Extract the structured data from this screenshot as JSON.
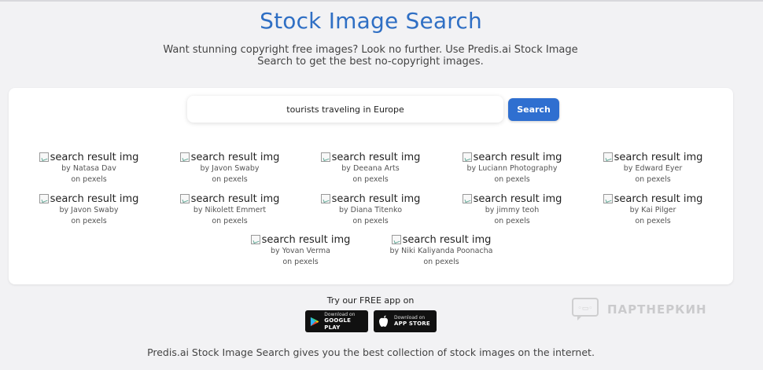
{
  "header": {
    "title": "Stock Image Search",
    "subtitle_line1": "Want stunning copyright free images? Look no further. Use Predis.ai Stock Image",
    "subtitle_line2": "Search to get the best no-copyright images."
  },
  "search": {
    "value": "tourists traveling in Europe",
    "button_label": "Search"
  },
  "results": [
    {
      "alt": "search result img",
      "by": "by Natasa Dav",
      "source": "on pexels"
    },
    {
      "alt": "search result img",
      "by": "by Javon Swaby",
      "source": "on pexels"
    },
    {
      "alt": "search result img",
      "by": "by Deeana Arts",
      "source": "on pexels"
    },
    {
      "alt": "search result img",
      "by": "by Luciann Photography",
      "source": "on pexels"
    },
    {
      "alt": "search result img",
      "by": "by Edward Eyer",
      "source": "on pexels"
    },
    {
      "alt": "search result img",
      "by": "by Javon Swaby",
      "source": "on pexels"
    },
    {
      "alt": "search result img",
      "by": "by Nikolett Emmert",
      "source": "on pexels"
    },
    {
      "alt": "search result img",
      "by": "by Diana Titenko",
      "source": "on pexels"
    },
    {
      "alt": "search result img",
      "by": "by jimmy teoh",
      "source": "on pexels"
    },
    {
      "alt": "search result img",
      "by": "by Kai Pilger",
      "source": "on pexels"
    },
    {
      "alt": "search result img",
      "by": "by Yovan Verma",
      "source": "on pexels"
    },
    {
      "alt": "search result img",
      "by": "by Niki Kaliyanda Poonacha",
      "source": "on pexels"
    }
  ],
  "app": {
    "title": "Try our FREE app on",
    "google": {
      "small": "Download on",
      "big": "GOOGLE PLAY"
    },
    "apple": {
      "small": "Download on",
      "big": "APP STORE"
    }
  },
  "footer": {
    "text": "Predis.ai Stock Image Search gives you the best collection of stock images on the internet."
  },
  "watermark": {
    "text": "ПАРТНЕРКИН"
  },
  "colors": {
    "accent": "#2f6fd0",
    "title": "#2f6fc4",
    "background": "#f2f2f4"
  }
}
